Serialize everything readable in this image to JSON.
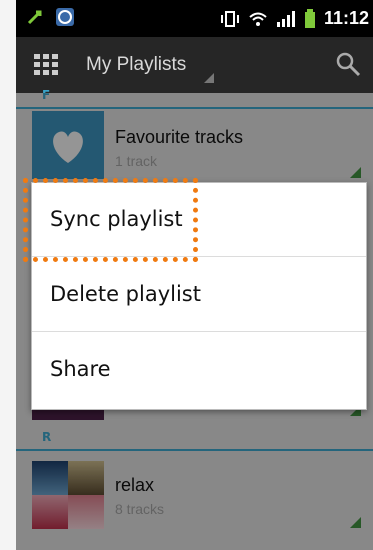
{
  "status_bar": {
    "time": "11:12",
    "icons": [
      "usb-icon",
      "app-notification-icon",
      "vibrate-icon",
      "wifi-icon",
      "signal-icon",
      "battery-icon"
    ]
  },
  "action_bar": {
    "title": "My Playlists",
    "icons": [
      "apps-grid-icon",
      "search-icon"
    ]
  },
  "sections": [
    {
      "letter": "F",
      "playlists": [
        {
          "name": "Favourite tracks",
          "count": "1 track",
          "thumb": "heart-icon"
        }
      ]
    },
    {
      "letter": "R",
      "playlists": [
        {
          "name": "relax",
          "count": "8 tracks",
          "thumb": "album-collage"
        }
      ]
    }
  ],
  "context_menu": {
    "items": [
      {
        "label": "Sync playlist",
        "highlighted": true
      },
      {
        "label": "Delete playlist"
      },
      {
        "label": "Share"
      }
    ]
  },
  "colors": {
    "accent": "#3aa3c8",
    "highlight": "#f07a10",
    "corner_marker": "#3f8f3f",
    "action_bar": "#262626"
  }
}
